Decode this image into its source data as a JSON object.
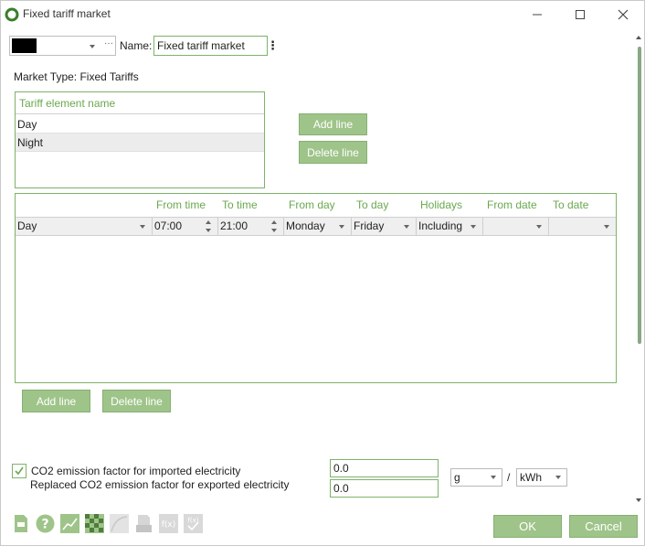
{
  "window": {
    "title": "Fixed tariff market",
    "icon": "app-ring-icon",
    "controls": [
      "minimize-icon",
      "maximize-icon",
      "close-icon"
    ]
  },
  "header": {
    "color_value": "#000000",
    "more_glyph": "···",
    "name_label": "Name:",
    "name_value": "Fixed tariff market",
    "menu_glyph": "⋮"
  },
  "market_type": "Market Type: Fixed Tariffs",
  "tariff_elements": {
    "header": "Tariff element name",
    "rows": [
      "Day",
      "Night"
    ],
    "add_line": "Add line",
    "delete_line": "Delete line"
  },
  "schedule": {
    "columns": [
      "",
      "From time",
      "To time",
      "From day",
      "To day",
      "Holidays",
      "From date",
      "To date"
    ],
    "rows": [
      {
        "element": "Day",
        "from_time": "07:00",
        "to_time": "21:00",
        "from_day": "Monday",
        "to_day": "Friday",
        "holidays": "Including",
        "from_date": "",
        "to_date": ""
      }
    ],
    "add_line": "Add line",
    "delete_line": "Delete line"
  },
  "co2": {
    "checkbox_checked": true,
    "imported_label": "CO2 emission factor for imported electricity",
    "exported_label": "Replaced CO2 emission factor for exported electricity",
    "imported_value": "0.0",
    "exported_value": "0.0",
    "unit_mass": "g",
    "separator": "/",
    "unit_energy": "kWh"
  },
  "toolbar": {
    "icons": [
      "document-icon",
      "help-icon",
      "chart-icon",
      "grid-icon",
      "curve-icon",
      "print-icon",
      "function-icon",
      "function-check-icon"
    ],
    "function_label": "f(x)"
  },
  "footer": {
    "ok": "OK",
    "cancel": "Cancel"
  },
  "colors": {
    "accent": "#9fc48a",
    "accent_text": "#6aa84f",
    "border": "#7eb36a"
  }
}
